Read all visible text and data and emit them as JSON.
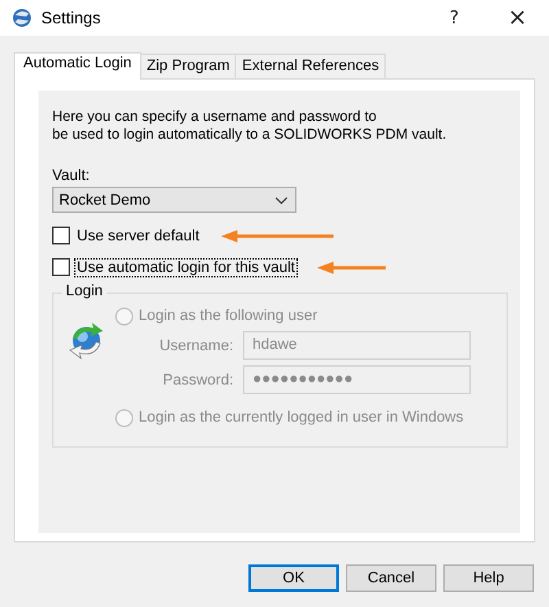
{
  "window": {
    "title": "Settings",
    "help": "?",
    "close": "×"
  },
  "tabs": [
    {
      "label": "Automatic Login",
      "selected": true
    },
    {
      "label": "Zip Program",
      "selected": false
    },
    {
      "label": "External References",
      "selected": false
    }
  ],
  "intro": [
    "Here you can specify a username and password to",
    "be used to login automatically to a SOLIDWORKS PDM vault."
  ],
  "vault": {
    "label": "Vault:",
    "value": "Rocket Demo"
  },
  "checkboxes": [
    {
      "label": "Use server default",
      "checked": false,
      "focused": false,
      "annotated": true
    },
    {
      "label": "Use automatic login for this vault",
      "checked": false,
      "focused": true,
      "annotated": true
    }
  ],
  "login": {
    "title": "Login",
    "disabled": true,
    "options": [
      {
        "label": "Login as the following user",
        "selected": false
      },
      {
        "label": "Login as the currently logged in user in Windows",
        "selected": false
      }
    ],
    "fields": [
      {
        "label": "Username:",
        "value": "hdawe"
      },
      {
        "label": "Password:",
        "value": "●●●●●●●●●●●"
      }
    ]
  },
  "buttons": [
    {
      "label": "OK",
      "default": true
    },
    {
      "label": "Cancel",
      "default": false
    },
    {
      "label": "Help",
      "default": false
    }
  ]
}
